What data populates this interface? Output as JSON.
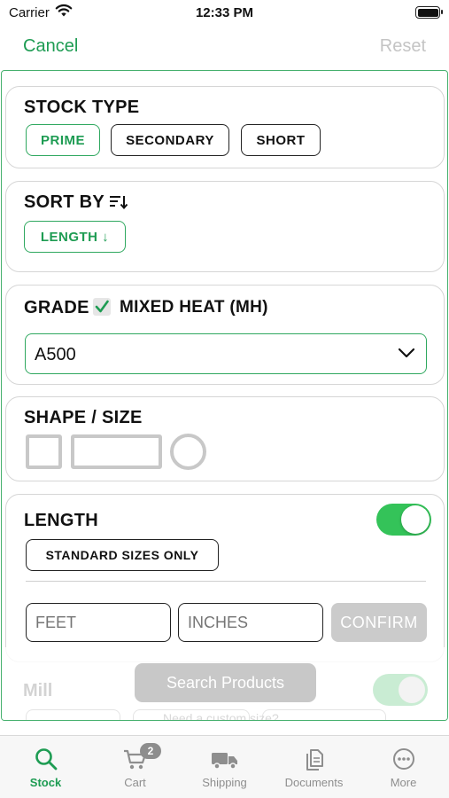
{
  "status_bar": {
    "carrier": "Carrier",
    "time": "12:33 PM",
    "wifi_icon": "wifi-icon",
    "battery_icon": "battery-full-icon"
  },
  "nav": {
    "cancel_label": "Cancel",
    "reset_label": "Reset"
  },
  "stock_type": {
    "title": "STOCK TYPE",
    "options": [
      {
        "label": "PRIME",
        "selected": true
      },
      {
        "label": "SECONDARY",
        "selected": false
      },
      {
        "label": "SHORT",
        "selected": false
      }
    ]
  },
  "sort_by": {
    "title": "SORT BY",
    "icon": "sort-descending-icon",
    "option_label": "LENGTH ↓"
  },
  "grade": {
    "title": "GRADE",
    "mixed_heat_label": "MIXED HEAT (MH)",
    "mixed_heat_checked": true,
    "selected_value": "A500"
  },
  "shape_size": {
    "title": "SHAPE / SIZE",
    "shapes": [
      "square-tube-icon",
      "rectangle-tube-icon",
      "round-tube-icon"
    ]
  },
  "length": {
    "title": "LENGTH",
    "toggle_on": true,
    "standard_sizes_label": "STANDARD SIZES ONLY",
    "feet_placeholder": "FEET",
    "inches_placeholder": "INCHES",
    "confirm_label": "CONFIRM"
  },
  "mill": {
    "title": "Mill",
    "custom_size_text": "Need a custom size?"
  },
  "search_label": "Search Products",
  "tabs": [
    {
      "label": "Stock",
      "icon": "search-icon",
      "active": true
    },
    {
      "label": "Cart",
      "icon": "cart-icon",
      "badge": "2",
      "active": false
    },
    {
      "label": "Shipping",
      "icon": "truck-icon",
      "active": false
    },
    {
      "label": "Documents",
      "icon": "documents-icon",
      "active": false
    },
    {
      "label": "More",
      "icon": "more-icon",
      "active": false
    }
  ],
  "colors": {
    "accent": "#1e9c53",
    "toggle": "#34c359",
    "disabled": "#c8c8c8"
  }
}
